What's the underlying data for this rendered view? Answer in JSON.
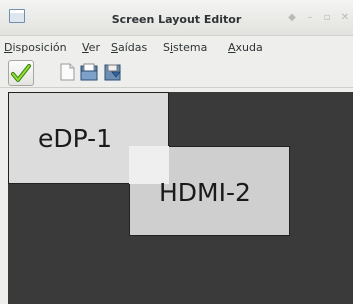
{
  "window": {
    "title": "Screen Layout Editor"
  },
  "menubar": {
    "items": [
      {
        "pre": "",
        "mnemonic": "D",
        "post": "isposición"
      },
      {
        "pre": "",
        "mnemonic": "V",
        "post": "er"
      },
      {
        "pre": "",
        "mnemonic": "S",
        "post": "aídas"
      },
      {
        "pre": "S",
        "mnemonic": "i",
        "post": "stema"
      },
      {
        "pre": "",
        "mnemonic": "A",
        "post": "xuda"
      }
    ]
  },
  "toolbar": {
    "buttons": [
      "apply-icon",
      "new-icon",
      "open-icon",
      "save-icon"
    ]
  },
  "screens": [
    {
      "name": "eDP-1"
    },
    {
      "name": "HDMI-2"
    }
  ],
  "colors": {
    "canvas_bg": "#3a3a3a",
    "edp_bg": "#dcdcdc",
    "hdmi_bg": "#cfcfcf",
    "apply_green": "#4e9a06"
  }
}
